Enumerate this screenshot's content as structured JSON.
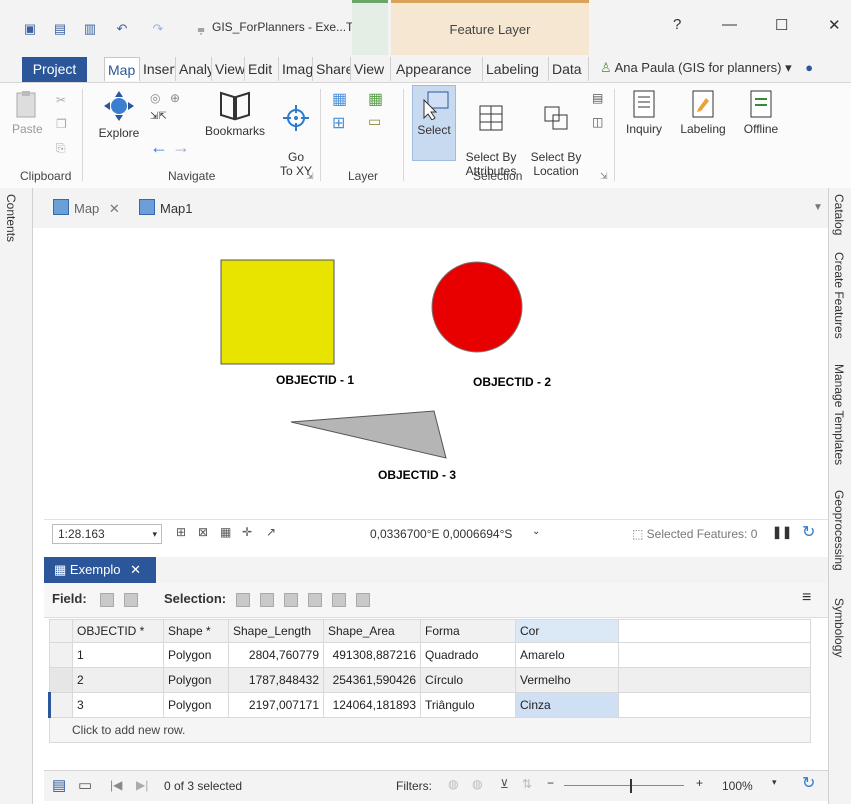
{
  "title_bar": {
    "doc_title": "GIS_ForPlanners - Exe...Ta...",
    "context_group": "Feature Layer",
    "help": "?",
    "minimize": "—",
    "maximize": "☐",
    "close": "✕"
  },
  "ribbon_tabs": {
    "project": "Project",
    "tabs": [
      "Map",
      "Insert",
      "Analysis",
      "View",
      "Edit",
      "Imagery",
      "Share",
      "View",
      "Appearance",
      "Labeling",
      "Data"
    ],
    "user": "Ana Paula (GIS for planners) ▾"
  },
  "ribbon": {
    "clipboard": {
      "paste": "Paste",
      "group": "Clipboard"
    },
    "navigate": {
      "explore": "Explore",
      "bookmarks": "Bookmarks",
      "goto": "Go\nTo XY",
      "group": "Navigate"
    },
    "layer": {
      "group": "Layer"
    },
    "selection": {
      "select": "Select",
      "by_attributes": "Select By\nAttributes",
      "by_location": "Select By\nLocation",
      "group": "Selection"
    },
    "inquiry": "Inquiry",
    "labeling": "Labeling",
    "offline": "Offline"
  },
  "side_left": {
    "contents": "Contents"
  },
  "side_right": [
    "Catalog",
    "Create Features",
    "Manage Templates",
    "Geoprocessing",
    "Symbology"
  ],
  "map_tabs": [
    {
      "label": "Map",
      "close": "✕"
    },
    {
      "label": "Map1"
    }
  ],
  "map": {
    "labels": [
      "OBJECTID - 1",
      "OBJECTID - 2",
      "OBJECTID - 3"
    ],
    "colors": {
      "square": "#e8e400",
      "circle": "#e80000",
      "triangle": "#b5b5b5"
    }
  },
  "map_status": {
    "scale": "1:28.163",
    "coords": "0,0336700°E 0,0006694°S",
    "selected_features": "Selected Features: 0"
  },
  "attribute_table": {
    "tab": "Exemplo",
    "field_label": "Field:",
    "selection_label": "Selection:",
    "columns": [
      "OBJECTID *",
      "Shape *",
      "Shape_Length",
      "Shape_Area",
      "Forma",
      "Cor"
    ],
    "rows": [
      [
        "1",
        "Polygon",
        "2804,760779",
        "491308,887216",
        "Quadrado",
        "Amarelo"
      ],
      [
        "2",
        "Polygon",
        "1787,848432",
        "254361,590426",
        "Círculo",
        "Vermelho"
      ],
      [
        "3",
        "Polygon",
        "2197,007171",
        "124064,181893",
        "Triângulo",
        "Cinza"
      ]
    ],
    "add_row": "Click to add new row."
  },
  "table_status": {
    "selected": "0 of 3 selected",
    "filters": "Filters:",
    "zoom": "100%"
  }
}
